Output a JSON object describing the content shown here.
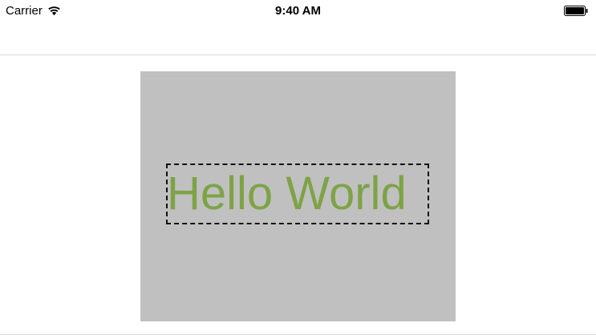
{
  "status_bar": {
    "carrier": "Carrier",
    "time": "9:40 AM",
    "wifi_icon": "wifi-icon",
    "battery_icon": "battery-icon"
  },
  "canvas": {
    "background": "#c0c0c0",
    "label_text": "Hello World",
    "label_color": "#7da346",
    "border_style": "dashed"
  }
}
